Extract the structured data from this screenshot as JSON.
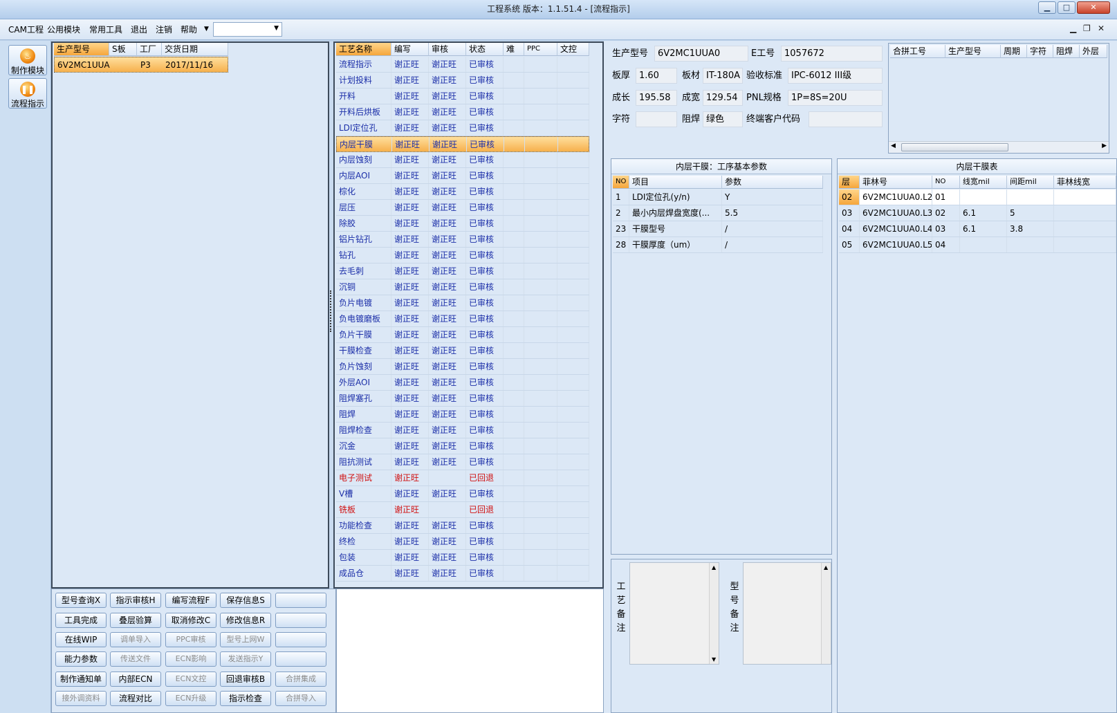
{
  "window": {
    "title": "工程系统   版本：1.1.51.4 - [流程指示]"
  },
  "menu": [
    "CAM工程",
    "公用模块",
    "常用工具",
    "退出",
    "注销",
    "帮助"
  ],
  "menu_combo": {
    "value": ""
  },
  "left_nav": [
    {
      "label": "制作模块",
      "icon": "fire-icon"
    },
    {
      "label": "流程指示",
      "icon": "pause-icon"
    }
  ],
  "product_grid": {
    "columns": [
      "生产型号",
      "S板",
      "工厂",
      "交货日期"
    ],
    "rows": [
      {
        "model": "6V2MC1UUA0",
        "s": "",
        "factory": "P3",
        "date": "2017/11/16"
      }
    ]
  },
  "process_grid": {
    "columns": [
      "工艺名称",
      "编写",
      "审核",
      "状态",
      "难",
      "PPC",
      "文控"
    ],
    "rows": [
      {
        "name": "流程指示",
        "writer": "谢正旺",
        "reviewer": "谢正旺",
        "status": "已审核",
        "red": false
      },
      {
        "name": "计划投料",
        "writer": "谢正旺",
        "reviewer": "谢正旺",
        "status": "已审核",
        "red": false
      },
      {
        "name": "开料",
        "writer": "谢正旺",
        "reviewer": "谢正旺",
        "status": "已审核",
        "red": false
      },
      {
        "name": "开料后烘板",
        "writer": "谢正旺",
        "reviewer": "谢正旺",
        "status": "已审核",
        "red": false
      },
      {
        "name": "LDI定位孔",
        "writer": "谢正旺",
        "reviewer": "谢正旺",
        "status": "已审核",
        "red": false
      },
      {
        "name": "内层干膜",
        "writer": "谢正旺",
        "reviewer": "谢正旺",
        "status": "已审核",
        "red": false,
        "selected": true
      },
      {
        "name": "内层蚀刻",
        "writer": "谢正旺",
        "reviewer": "谢正旺",
        "status": "已审核",
        "red": false
      },
      {
        "name": "内层AOI",
        "writer": "谢正旺",
        "reviewer": "谢正旺",
        "status": "已审核",
        "red": false
      },
      {
        "name": "棕化",
        "writer": "谢正旺",
        "reviewer": "谢正旺",
        "status": "已审核",
        "red": false
      },
      {
        "name": "层压",
        "writer": "谢正旺",
        "reviewer": "谢正旺",
        "status": "已审核",
        "red": false
      },
      {
        "name": "除胶",
        "writer": "谢正旺",
        "reviewer": "谢正旺",
        "status": "已审核",
        "red": false
      },
      {
        "name": "铝片钻孔",
        "writer": "谢正旺",
        "reviewer": "谢正旺",
        "status": "已审核",
        "red": false
      },
      {
        "name": "钻孔",
        "writer": "谢正旺",
        "reviewer": "谢正旺",
        "status": "已审核",
        "red": false
      },
      {
        "name": "去毛刺",
        "writer": "谢正旺",
        "reviewer": "谢正旺",
        "status": "已审核",
        "red": false
      },
      {
        "name": "沉铜",
        "writer": "谢正旺",
        "reviewer": "谢正旺",
        "status": "已审核",
        "red": false
      },
      {
        "name": "负片电镀",
        "writer": "谢正旺",
        "reviewer": "谢正旺",
        "status": "已审核",
        "red": false
      },
      {
        "name": "负电镀磨板",
        "writer": "谢正旺",
        "reviewer": "谢正旺",
        "status": "已审核",
        "red": false
      },
      {
        "name": "负片干膜",
        "writer": "谢正旺",
        "reviewer": "谢正旺",
        "status": "已审核",
        "red": false
      },
      {
        "name": "干膜检查",
        "writer": "谢正旺",
        "reviewer": "谢正旺",
        "status": "已审核",
        "red": false
      },
      {
        "name": "负片蚀刻",
        "writer": "谢正旺",
        "reviewer": "谢正旺",
        "status": "已审核",
        "red": false
      },
      {
        "name": "外层AOI",
        "writer": "谢正旺",
        "reviewer": "谢正旺",
        "status": "已审核",
        "red": false
      },
      {
        "name": "阻焊塞孔",
        "writer": "谢正旺",
        "reviewer": "谢正旺",
        "status": "已审核",
        "red": false
      },
      {
        "name": "阻焊",
        "writer": "谢正旺",
        "reviewer": "谢正旺",
        "status": "已审核",
        "red": false
      },
      {
        "name": "阻焊检查",
        "writer": "谢正旺",
        "reviewer": "谢正旺",
        "status": "已审核",
        "red": false
      },
      {
        "name": "沉金",
        "writer": "谢正旺",
        "reviewer": "谢正旺",
        "status": "已审核",
        "red": false
      },
      {
        "name": "阻抗测试",
        "writer": "谢正旺",
        "reviewer": "谢正旺",
        "status": "已审核",
        "red": false
      },
      {
        "name": "电子测试",
        "writer": "谢正旺",
        "reviewer": "",
        "status": "已回退",
        "red": true
      },
      {
        "name": "V槽",
        "writer": "谢正旺",
        "reviewer": "谢正旺",
        "status": "已审核",
        "red": false
      },
      {
        "name": "铣板",
        "writer": "谢正旺",
        "reviewer": "",
        "status": "已回退",
        "red": true
      },
      {
        "name": "功能检查",
        "writer": "谢正旺",
        "reviewer": "谢正旺",
        "status": "已审核",
        "red": false
      },
      {
        "name": "终检",
        "writer": "谢正旺",
        "reviewer": "谢正旺",
        "status": "已审核",
        "red": false
      },
      {
        "name": "包装",
        "writer": "谢正旺",
        "reviewer": "谢正旺",
        "status": "已审核",
        "red": false
      },
      {
        "name": "成品仓",
        "writer": "谢正旺",
        "reviewer": "谢正旺",
        "status": "已审核",
        "red": false
      }
    ]
  },
  "info": {
    "model_label": "生产型号",
    "model": "6V2MC1UUA0",
    "eno_label": "E工号",
    "eno": "1057672",
    "thickness_label": "板厚",
    "thickness": "1.60",
    "material_label": "板材",
    "material": "IT-180A",
    "standard_label": "验收标准",
    "standard": "IPC-6012 III级",
    "length_label": "成长",
    "length": "195.58",
    "width_label": "成宽",
    "width": "129.54",
    "pnl_label": "PNL规格",
    "pnl": "1P=8S=20U",
    "char_label": "字符",
    "char": "",
    "mask_label": "阻焊",
    "mask": "绿色",
    "customer_label": "终端客户代码",
    "customer": ""
  },
  "merge_grid": {
    "columns": [
      "合拼工号",
      "生产型号",
      "周期",
      "字符",
      "阻焊",
      "外层"
    ]
  },
  "params": {
    "title": "内层干膜：工序基本参数",
    "columns": [
      "NO",
      "项目",
      "参数"
    ],
    "rows": [
      {
        "no": "1",
        "item": "LDI定位孔(y/n)",
        "value": "Y"
      },
      {
        "no": "2",
        "item": "最小内层焊盘宽度(...",
        "value": "5.5"
      },
      {
        "no": "23",
        "item": "干膜型号",
        "value": "/"
      },
      {
        "no": "28",
        "item": "干膜厚度（um）",
        "value": "/"
      }
    ]
  },
  "film_table": {
    "title": "内层干膜表",
    "columns": [
      "层",
      "菲林号",
      "NO",
      "线宽mil",
      "间距mil",
      "菲林线宽"
    ],
    "rows": [
      {
        "layer": "02",
        "film": "6V2MC1UUA0.L2",
        "no": "01",
        "lw": "",
        "sp": ""
      },
      {
        "layer": "03",
        "film": "6V2MC1UUA0.L3",
        "no": "02",
        "lw": "6.1",
        "sp": "5"
      },
      {
        "layer": "04",
        "film": "6V2MC1UUA0.L4",
        "no": "03",
        "lw": "6.1",
        "sp": "3.8"
      },
      {
        "layer": "05",
        "film": "6V2MC1UUA0.L5",
        "no": "04",
        "lw": "",
        "sp": ""
      }
    ]
  },
  "memo": {
    "process_label": "工艺备注",
    "model_label": "型号备注"
  },
  "buttons": [
    [
      {
        "label": "型号查询X",
        "enabled": true
      },
      {
        "label": "指示审核H",
        "enabled": true
      },
      {
        "label": "编写流程F",
        "enabled": true
      },
      {
        "label": "保存信息S",
        "enabled": true
      },
      {
        "label": "",
        "enabled": true
      }
    ],
    [
      {
        "label": "工具完成",
        "enabled": true
      },
      {
        "label": "叠层验算",
        "enabled": true
      },
      {
        "label": "取消修改C",
        "enabled": true
      },
      {
        "label": "修改信息R",
        "enabled": true
      },
      {
        "label": "",
        "enabled": true
      }
    ],
    [
      {
        "label": "在线WIP",
        "enabled": true
      },
      {
        "label": "调单导入",
        "enabled": false
      },
      {
        "label": "PPC审核",
        "enabled": false
      },
      {
        "label": "型号上网W",
        "enabled": false
      },
      {
        "label": "",
        "enabled": true
      }
    ],
    [
      {
        "label": "能力参数",
        "enabled": true
      },
      {
        "label": "传送文件",
        "enabled": false
      },
      {
        "label": "ECN影响",
        "enabled": false
      },
      {
        "label": "发送指示Y",
        "enabled": false
      },
      {
        "label": "",
        "enabled": true
      }
    ],
    [
      {
        "label": "制作通知单",
        "enabled": true
      },
      {
        "label": "内部ECN",
        "enabled": true
      },
      {
        "label": "ECN文控",
        "enabled": false
      },
      {
        "label": "回退审核B",
        "enabled": true
      },
      {
        "label": "合拼集成",
        "enabled": false
      }
    ],
    [
      {
        "label": "接外调资料",
        "enabled": false
      },
      {
        "label": "流程对比",
        "enabled": true
      },
      {
        "label": "ECN升级",
        "enabled": false
      },
      {
        "label": "指示检查",
        "enabled": true
      },
      {
        "label": "合拼导入",
        "enabled": false
      }
    ]
  ]
}
